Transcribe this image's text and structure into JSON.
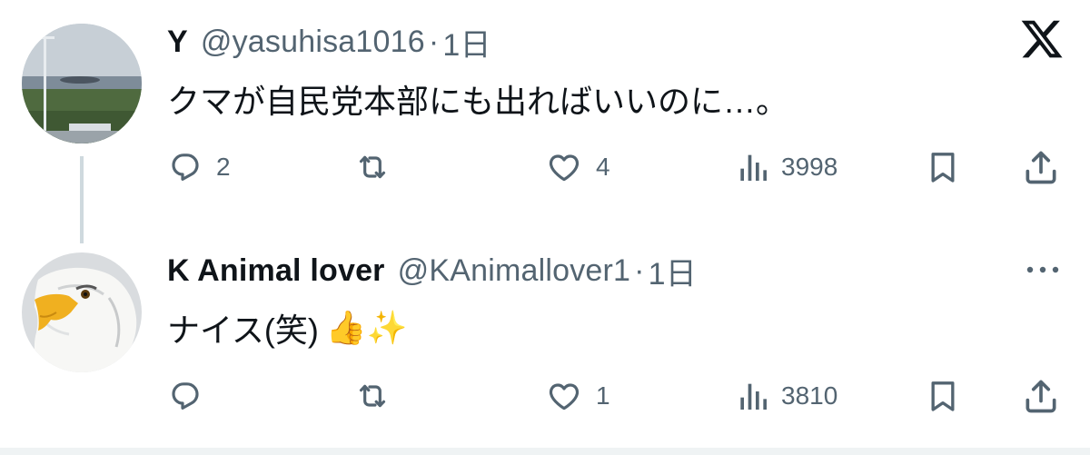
{
  "tweets": [
    {
      "name": "Y",
      "handle": "@yasuhisa1016",
      "separator": "·",
      "time": "1日",
      "text": "クマが自民党本部にも出ればいいのに…。",
      "replies": "2",
      "retweets": "",
      "likes": "4",
      "views": "3998"
    },
    {
      "name": "K Animal lover",
      "handle": "@KAnimallover1",
      "separator": "·",
      "time": "1日",
      "text": "ナイス(笑)",
      "emojis": "👍✨",
      "replies": "",
      "retweets": "",
      "likes": "1",
      "views": "3810"
    }
  ],
  "icons": {
    "app_logo": "x-logo-icon",
    "more": "more-options-icon",
    "reply": "reply-icon",
    "retweet": "retweet-icon",
    "like": "heart-icon",
    "views": "views-icon",
    "bookmark": "bookmark-icon",
    "share": "share-icon"
  },
  "colors": {
    "text": "#0f1419",
    "secondary": "#536471",
    "thread_line": "#cfd9de"
  }
}
